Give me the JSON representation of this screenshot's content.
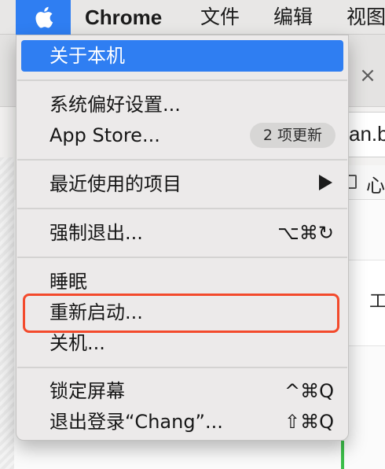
{
  "menubar": {
    "app_name": "Chrome",
    "items": [
      "文件",
      "编辑",
      "视图"
    ]
  },
  "background": {
    "address_fragment": "an.b",
    "bookmark_fragment": "心",
    "panel_fragment": "工",
    "close_glyph": "×"
  },
  "apple_menu": {
    "about": "关于本机",
    "system_prefs": "系统偏好设置...",
    "app_store": "App Store...",
    "app_store_badge": "2 项更新",
    "recent_items": "最近使用的项目",
    "force_quit": "强制退出...",
    "force_quit_shortcut": "⌥⌘↻",
    "sleep": "睡眠",
    "restart": "重新启动...",
    "shutdown": "关机...",
    "lock_screen": "锁定屏幕",
    "lock_screen_shortcut": "^⌘Q",
    "log_out": "退出登录“Chang”...",
    "log_out_shortcut": "⇧⌘Q"
  },
  "colors": {
    "highlight": "#2f7ef2",
    "focus_ring": "#f34a2c"
  },
  "icons": {
    "apple": "apple-logo-icon",
    "submenu": "triangle-right-icon"
  }
}
